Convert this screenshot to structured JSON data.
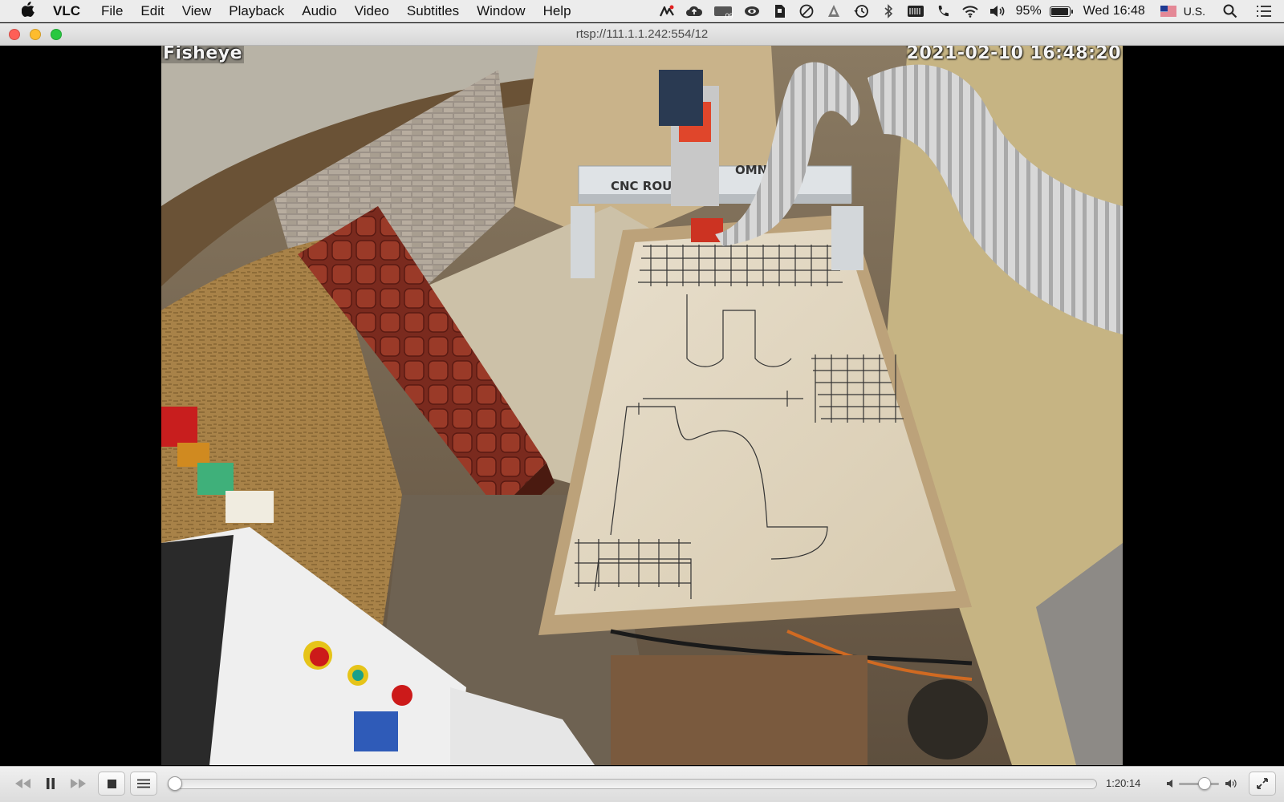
{
  "menubar": {
    "apple_icon": "apple-icon",
    "items": [
      "VLC",
      "File",
      "Edit",
      "View",
      "Playback",
      "Audio",
      "Video",
      "Subtitles",
      "Window",
      "Help"
    ],
    "status": {
      "battery_percent": "95%",
      "battery_level": 0.95,
      "datetime": "Wed 16:48",
      "input_source": "U.S.",
      "icons": [
        "scribble-icon",
        "cloud-upload-icon",
        "cpu-temp-icon",
        "eye-icon",
        "evernote-icon",
        "do-not-disturb-icon",
        "vpn-icon",
        "time-machine-icon",
        "bluetooth-icon",
        "keyboard-icon",
        "phone-icon",
        "wifi-icon",
        "volume-icon",
        "battery-icon",
        "flag-icon",
        "spotlight-icon",
        "control-center-icon"
      ],
      "cpu_badge": ".09"
    }
  },
  "window": {
    "title": "rtsp://111.1.1.242:554/12",
    "buttons": [
      "close-button",
      "minimize-button",
      "zoom-button"
    ]
  },
  "video": {
    "osd_label": "Fisheye",
    "osd_timestamp": "2021-02-10 16:48:20",
    "machine_label_left": "CNC ROUTE",
    "machine_label_right": "OMN   ATC"
  },
  "controls": {
    "elapsed_time": "1:20:14",
    "seek_position": 0.0,
    "volume_level": 0.7,
    "colors": {
      "seek_fill": "#8fb7e8"
    }
  }
}
